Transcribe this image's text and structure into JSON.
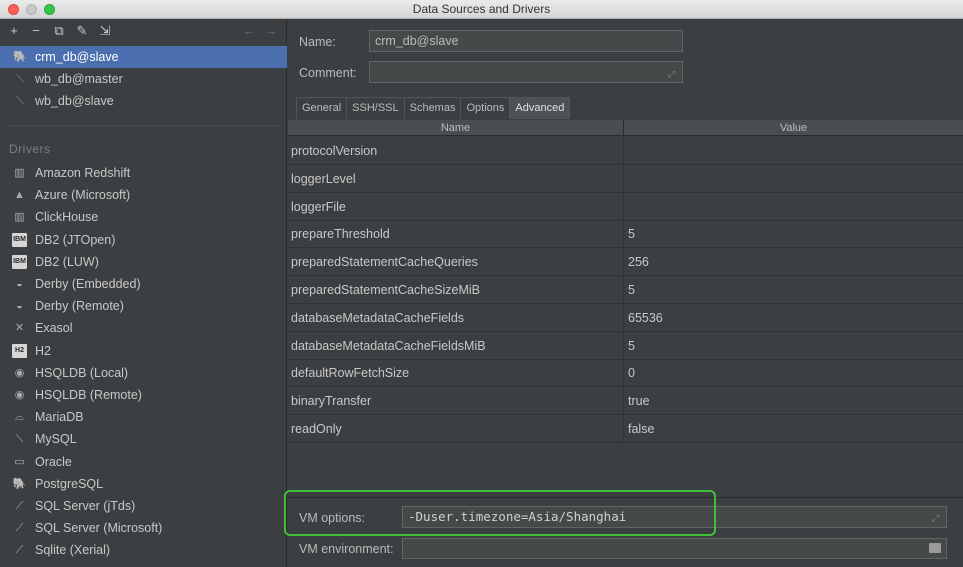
{
  "window": {
    "title": "Data Sources and Drivers"
  },
  "toolbar": {
    "add": "+",
    "remove": "−",
    "duplicate": "⧉",
    "settings": "✎",
    "import": "⇲",
    "back": "←",
    "forward": "→"
  },
  "data_sources": [
    {
      "label": "crm_db@slave",
      "icon": "postgres-elephant-icon",
      "glyph": "🐘",
      "selected": true
    },
    {
      "label": "wb_db@master",
      "icon": "mysql-dolphin-icon",
      "glyph": "⟍",
      "selected": false
    },
    {
      "label": "wb_db@slave",
      "icon": "mysql-dolphin-icon",
      "glyph": "⟍",
      "selected": false
    }
  ],
  "drivers_section": {
    "title": "Drivers"
  },
  "drivers": [
    {
      "label": "Amazon Redshift",
      "icon": "redshift-icon",
      "glyph": "▥"
    },
    {
      "label": "Azure (Microsoft)",
      "icon": "azure-icon",
      "glyph": "▲"
    },
    {
      "label": "ClickHouse",
      "icon": "clickhouse-icon",
      "glyph": "▥"
    },
    {
      "label": "DB2 (JTOpen)",
      "icon": "ibm-db2-icon",
      "glyph": "IBM"
    },
    {
      "label": "DB2 (LUW)",
      "icon": "ibm-db2-icon",
      "glyph": "IBM"
    },
    {
      "label": "Derby (Embedded)",
      "icon": "derby-hat-icon",
      "glyph": "◒"
    },
    {
      "label": "Derby (Remote)",
      "icon": "derby-hat-icon",
      "glyph": "◒"
    },
    {
      "label": "Exasol",
      "icon": "exasol-icon",
      "glyph": "✕"
    },
    {
      "label": "H2",
      "icon": "h2-icon",
      "glyph": "H2"
    },
    {
      "label": "HSQLDB (Local)",
      "icon": "hsqldb-icon",
      "glyph": "◉"
    },
    {
      "label": "HSQLDB (Remote)",
      "icon": "hsqldb-icon",
      "glyph": "◉"
    },
    {
      "label": "MariaDB",
      "icon": "mariadb-seal-icon",
      "glyph": "⌓"
    },
    {
      "label": "MySQL",
      "icon": "mysql-dolphin-icon",
      "glyph": "⟍"
    },
    {
      "label": "Oracle",
      "icon": "oracle-icon",
      "glyph": "▭"
    },
    {
      "label": "PostgreSQL",
      "icon": "postgres-elephant-icon",
      "glyph": "🐘"
    },
    {
      "label": "SQL Server (jTds)",
      "icon": "sqlserver-icon",
      "glyph": "⟋"
    },
    {
      "label": "SQL Server (Microsoft)",
      "icon": "sqlserver-icon",
      "glyph": "⟋"
    },
    {
      "label": "Sqlite (Xerial)",
      "icon": "sqlite-feather-icon",
      "glyph": "⟋"
    }
  ],
  "form": {
    "name_label": "Name:",
    "name_value": "crm_db@slave",
    "comment_label": "Comment:",
    "comment_value": ""
  },
  "tabs": [
    {
      "label": "General",
      "active": false
    },
    {
      "label": "SSH/SSL",
      "active": false
    },
    {
      "label": "Schemas",
      "active": false
    },
    {
      "label": "Options",
      "active": false
    },
    {
      "label": "Advanced",
      "active": true
    }
  ],
  "properties_table": {
    "columns": [
      "Name",
      "Value"
    ],
    "rows": [
      {
        "name": "protocolVersion",
        "value": ""
      },
      {
        "name": "loggerLevel",
        "value": ""
      },
      {
        "name": "loggerFile",
        "value": ""
      },
      {
        "name": "prepareThreshold",
        "value": "5"
      },
      {
        "name": "preparedStatementCacheQueries",
        "value": "256"
      },
      {
        "name": "preparedStatementCacheSizeMiB",
        "value": "5"
      },
      {
        "name": "databaseMetadataCacheFields",
        "value": "65536"
      },
      {
        "name": "databaseMetadataCacheFieldsMiB",
        "value": "5"
      },
      {
        "name": "defaultRowFetchSize",
        "value": "0"
      },
      {
        "name": "binaryTransfer",
        "value": "true"
      },
      {
        "name": "readOnly",
        "value": "false"
      }
    ]
  },
  "vm": {
    "options_label": "VM options:",
    "options_value": "-Duser.timezone=Asia/Shanghai",
    "environment_label": "VM environment:",
    "environment_value": ""
  },
  "colors": {
    "selection": "#4b6eaf",
    "highlight": "#3ec13a",
    "background": "#3c3f41"
  }
}
